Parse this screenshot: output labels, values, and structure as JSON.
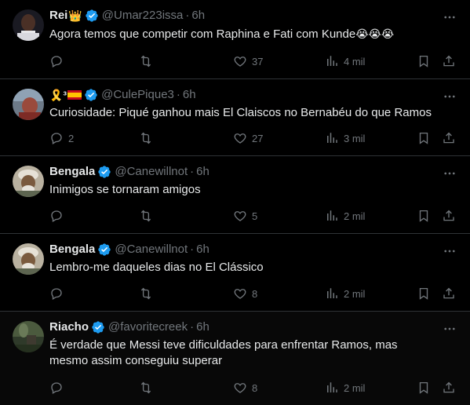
{
  "tweets": [
    {
      "name": "Rei",
      "name_suffix": "👑",
      "handle": "@Umar223issa",
      "separator": "·",
      "time": "6h",
      "text": "Agora temos que competir com Raphina e Fati com Kunde",
      "emoji": "😭😭😭",
      "reply_count": "",
      "retweet_count": "",
      "like_count": "37",
      "view_count": "4 mil"
    },
    {
      "name": "🎗️³",
      "name_suffix": "🇪🇸",
      "handle": "@CulePique3",
      "separator": "·",
      "time": "6h",
      "text": "Curiosidade: Piqué ganhou mais El Claiscos no Bernabéu do que Ramos",
      "reply_count": "2",
      "retweet_count": "",
      "like_count": "27",
      "view_count": "3 mil"
    },
    {
      "name": "Bengala",
      "handle": "@Canewillnot",
      "separator": "·",
      "time": "6h",
      "text": "Inimigos se tornaram amigos",
      "reply_count": "",
      "retweet_count": "",
      "like_count": "5",
      "view_count": "2 mil"
    },
    {
      "name": "Bengala",
      "handle": "@Canewillnot",
      "separator": "·",
      "time": "6h",
      "text": "Lembro-me daqueles dias no El Clássico",
      "reply_count": "",
      "retweet_count": "",
      "like_count": "8",
      "view_count": "2 mil"
    },
    {
      "name": "Riacho",
      "handle": "@favoritecreek",
      "separator": "·",
      "time": "6h",
      "text": "É verdade que Messi teve dificuldades para enfrentar Ramos, mas mesmo assim conseguiu superar",
      "reply_count": "",
      "retweet_count": "",
      "like_count": "8",
      "view_count": "2 mil"
    }
  ],
  "colors": {
    "background": "#000000",
    "text": "#e7e9ea",
    "muted": "#71767b",
    "border": "#2f3336",
    "verified": "#1d9bf0"
  },
  "icons": {
    "verified": "verified-badge-icon",
    "more": "more-icon",
    "reply": "reply-icon",
    "retweet": "retweet-icon",
    "like": "heart-icon",
    "views": "views-icon",
    "bookmark": "bookmark-icon",
    "share": "share-icon"
  }
}
